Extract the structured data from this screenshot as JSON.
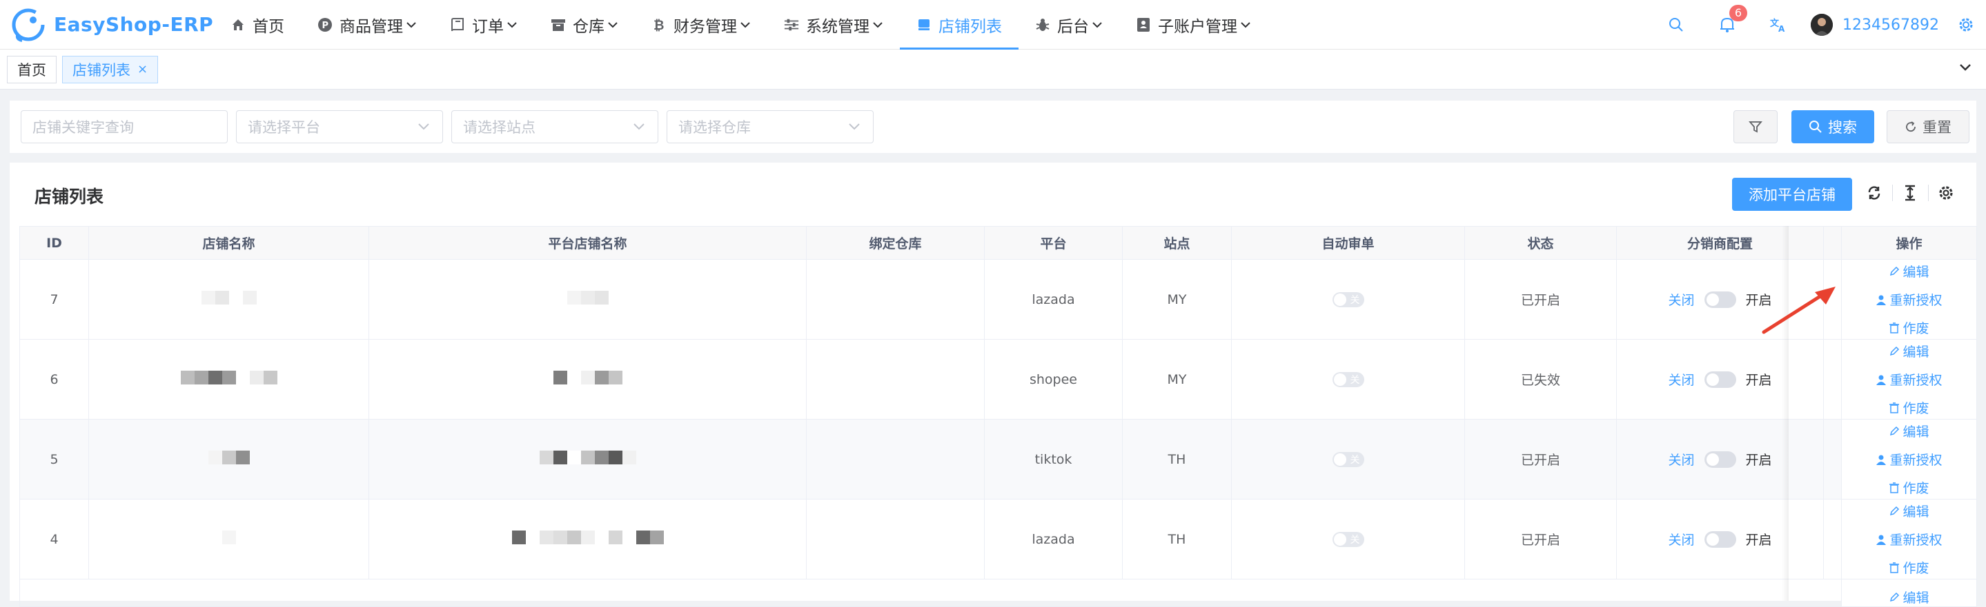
{
  "app": {
    "logo_text": "EasyShop-ERP"
  },
  "menu": [
    {
      "label": "首页",
      "icon": "home-icon",
      "active": false,
      "has_chevron": false
    },
    {
      "label": "商品管理",
      "icon": "product-p-icon",
      "active": false,
      "has_chevron": true
    },
    {
      "label": "订单",
      "icon": "book-icon",
      "active": false,
      "has_chevron": true
    },
    {
      "label": "仓库",
      "icon": "archive-icon",
      "active": false,
      "has_chevron": true
    },
    {
      "label": "财务管理",
      "icon": "bitcoin-icon",
      "active": false,
      "has_chevron": true
    },
    {
      "label": "系统管理",
      "icon": "sliders-icon",
      "active": false,
      "has_chevron": true
    },
    {
      "label": "店铺列表",
      "icon": "shop-icon",
      "active": true,
      "has_chevron": false
    },
    {
      "label": "后台",
      "icon": "bug-icon",
      "active": false,
      "has_chevron": true
    },
    {
      "label": "子账户管理",
      "icon": "user-card-icon",
      "active": false,
      "has_chevron": true
    }
  ],
  "header_right": {
    "notification_count": "6",
    "username": "1234567892"
  },
  "tags": [
    {
      "label": "首页",
      "active": false,
      "closable": false
    },
    {
      "label": "店铺列表",
      "active": true,
      "closable": true,
      "close_glyph": "×"
    }
  ],
  "filters": {
    "keyword_placeholder": "店铺关键字查询",
    "platform_placeholder": "请选择平台",
    "site_placeholder": "请选择站点",
    "warehouse_placeholder": "请选择仓库",
    "search_label": "搜索",
    "reset_label": "重置"
  },
  "list": {
    "title": "店铺列表",
    "add_label": "添加平台店铺",
    "columns": [
      "ID",
      "店铺名称",
      "平台店铺名称",
      "绑定仓库",
      "平台",
      "站点",
      "自动审单",
      "状态",
      "分销商配置",
      "",
      "操作"
    ],
    "switch_off_text": "关",
    "dist_off": "关闭",
    "dist_on": "开启",
    "ops": {
      "edit": "编辑",
      "reauth": "重新授权",
      "void": "作废"
    },
    "rows": [
      {
        "id": "7",
        "platform": "lazada",
        "site": "MY",
        "status": "已开启"
      },
      {
        "id": "6",
        "platform": "shopee",
        "site": "MY",
        "status": "已失效"
      },
      {
        "id": "5",
        "platform": "tiktok",
        "site": "TH",
        "status": "已开启"
      },
      {
        "id": "4",
        "platform": "lazada",
        "site": "TH",
        "status": "已开启"
      }
    ]
  },
  "colors": {
    "primary": "#409eff",
    "annotation_arrow": "#e8412f",
    "badge": "#f56c6c"
  }
}
